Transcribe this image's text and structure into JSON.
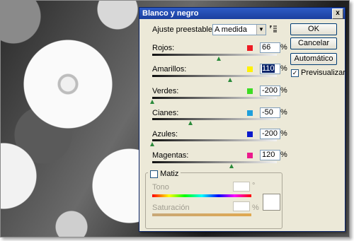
{
  "dialog": {
    "title": "Blanco y negro",
    "close_glyph": "x"
  },
  "preset": {
    "label": "Ajuste preestablecido:",
    "value": "A medida"
  },
  "buttons": {
    "ok": "OK",
    "cancel": "Cancelar",
    "auto": "Automático"
  },
  "preview": {
    "label": "Previsualizar",
    "checked": true,
    "check_glyph": "✓"
  },
  "sliders": [
    {
      "label": "Rojos:",
      "value": "66",
      "unit": "%",
      "color": "#ee1c24"
    },
    {
      "label": "Amarillos:",
      "value": "110",
      "unit": "%",
      "color": "#fff200"
    },
    {
      "label": "Verdes:",
      "value": "-200",
      "unit": "%",
      "color": "#3ddc23"
    },
    {
      "label": "Cianes:",
      "value": "-50",
      "unit": "%",
      "color": "#1e9fdc"
    },
    {
      "label": "Azules:",
      "value": "-200",
      "unit": "%",
      "color": "#0a1acc"
    },
    {
      "label": "Magentas:",
      "value": "120",
      "unit": "%",
      "color": "#ec1a8c"
    }
  ],
  "tint": {
    "label": "Matiz",
    "checked": false,
    "hue_label": "Tono",
    "hue_unit": "°",
    "saturation_label": "Saturación",
    "saturation_unit": "%"
  }
}
